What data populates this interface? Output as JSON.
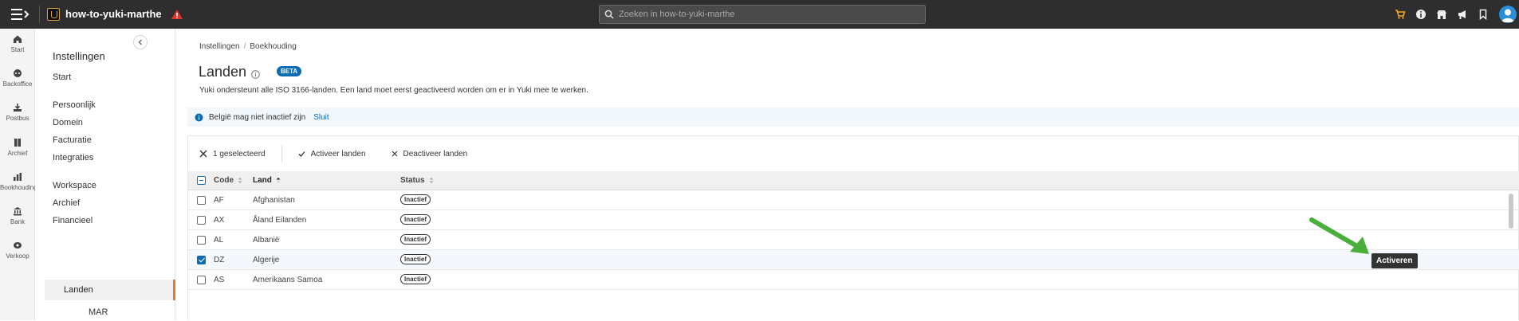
{
  "topbar": {
    "app_name": "how-to-yuki-marthe",
    "search_placeholder": "Zoeken in how-to-yuki-marthe"
  },
  "rail": {
    "items": [
      {
        "label": "Start",
        "icon": "home-icon"
      },
      {
        "label": "Backoffice",
        "icon": "backoffice-icon"
      },
      {
        "label": "Postbus",
        "icon": "inbox-icon"
      },
      {
        "label": "Archief",
        "icon": "archive-icon"
      },
      {
        "label": "Bookhouding",
        "icon": "bar-chart-icon"
      },
      {
        "label": "Bank",
        "icon": "bank-icon"
      },
      {
        "label": "Verkoop",
        "icon": "sales-icon"
      }
    ]
  },
  "panel": {
    "title": "Instellingen",
    "items": [
      "Start",
      "Persoonlijk",
      "Domein",
      "Facturatie",
      "Integraties",
      "Workspace",
      "Archief",
      "Financieel"
    ],
    "active": "Landen",
    "next": "MAR"
  },
  "main": {
    "breadcrumb": [
      "Instellingen",
      "Boekhouding"
    ],
    "title": "Landen",
    "beta": "BETA",
    "subtitle": "Yuki ondersteunt alle ISO 3166-landen. Een land moet eerst geactiveerd worden om er in Yuki mee te werken.",
    "alert": {
      "text": "België mag niet inactief zijn",
      "link": "Sluit"
    },
    "actions": {
      "selected": "1 geselecteerd",
      "activate": "Activeer landen",
      "deactivate": "Deactiveer landen"
    },
    "columns": {
      "code": "Code",
      "land": "Land",
      "status": "Status"
    },
    "rows": [
      {
        "code": "AF",
        "land": "Afghanistan",
        "status": "Inactief",
        "selected": false
      },
      {
        "code": "AX",
        "land": "Åland Eilanden",
        "status": "Inactief",
        "selected": false
      },
      {
        "code": "AL",
        "land": "Albanië",
        "status": "Inactief",
        "selected": false
      },
      {
        "code": "DZ",
        "land": "Algerije",
        "status": "Inactief",
        "selected": true
      },
      {
        "code": "AS",
        "land": "Amerikaans Samoa",
        "status": "Inactief",
        "selected": false
      }
    ],
    "tooltip": "Activeren"
  },
  "colors": {
    "topbar": "#2e2e2e",
    "accent": "#0b6bb3",
    "active_marker": "#e8762b",
    "annotation_arrow": "#4caf3c"
  }
}
